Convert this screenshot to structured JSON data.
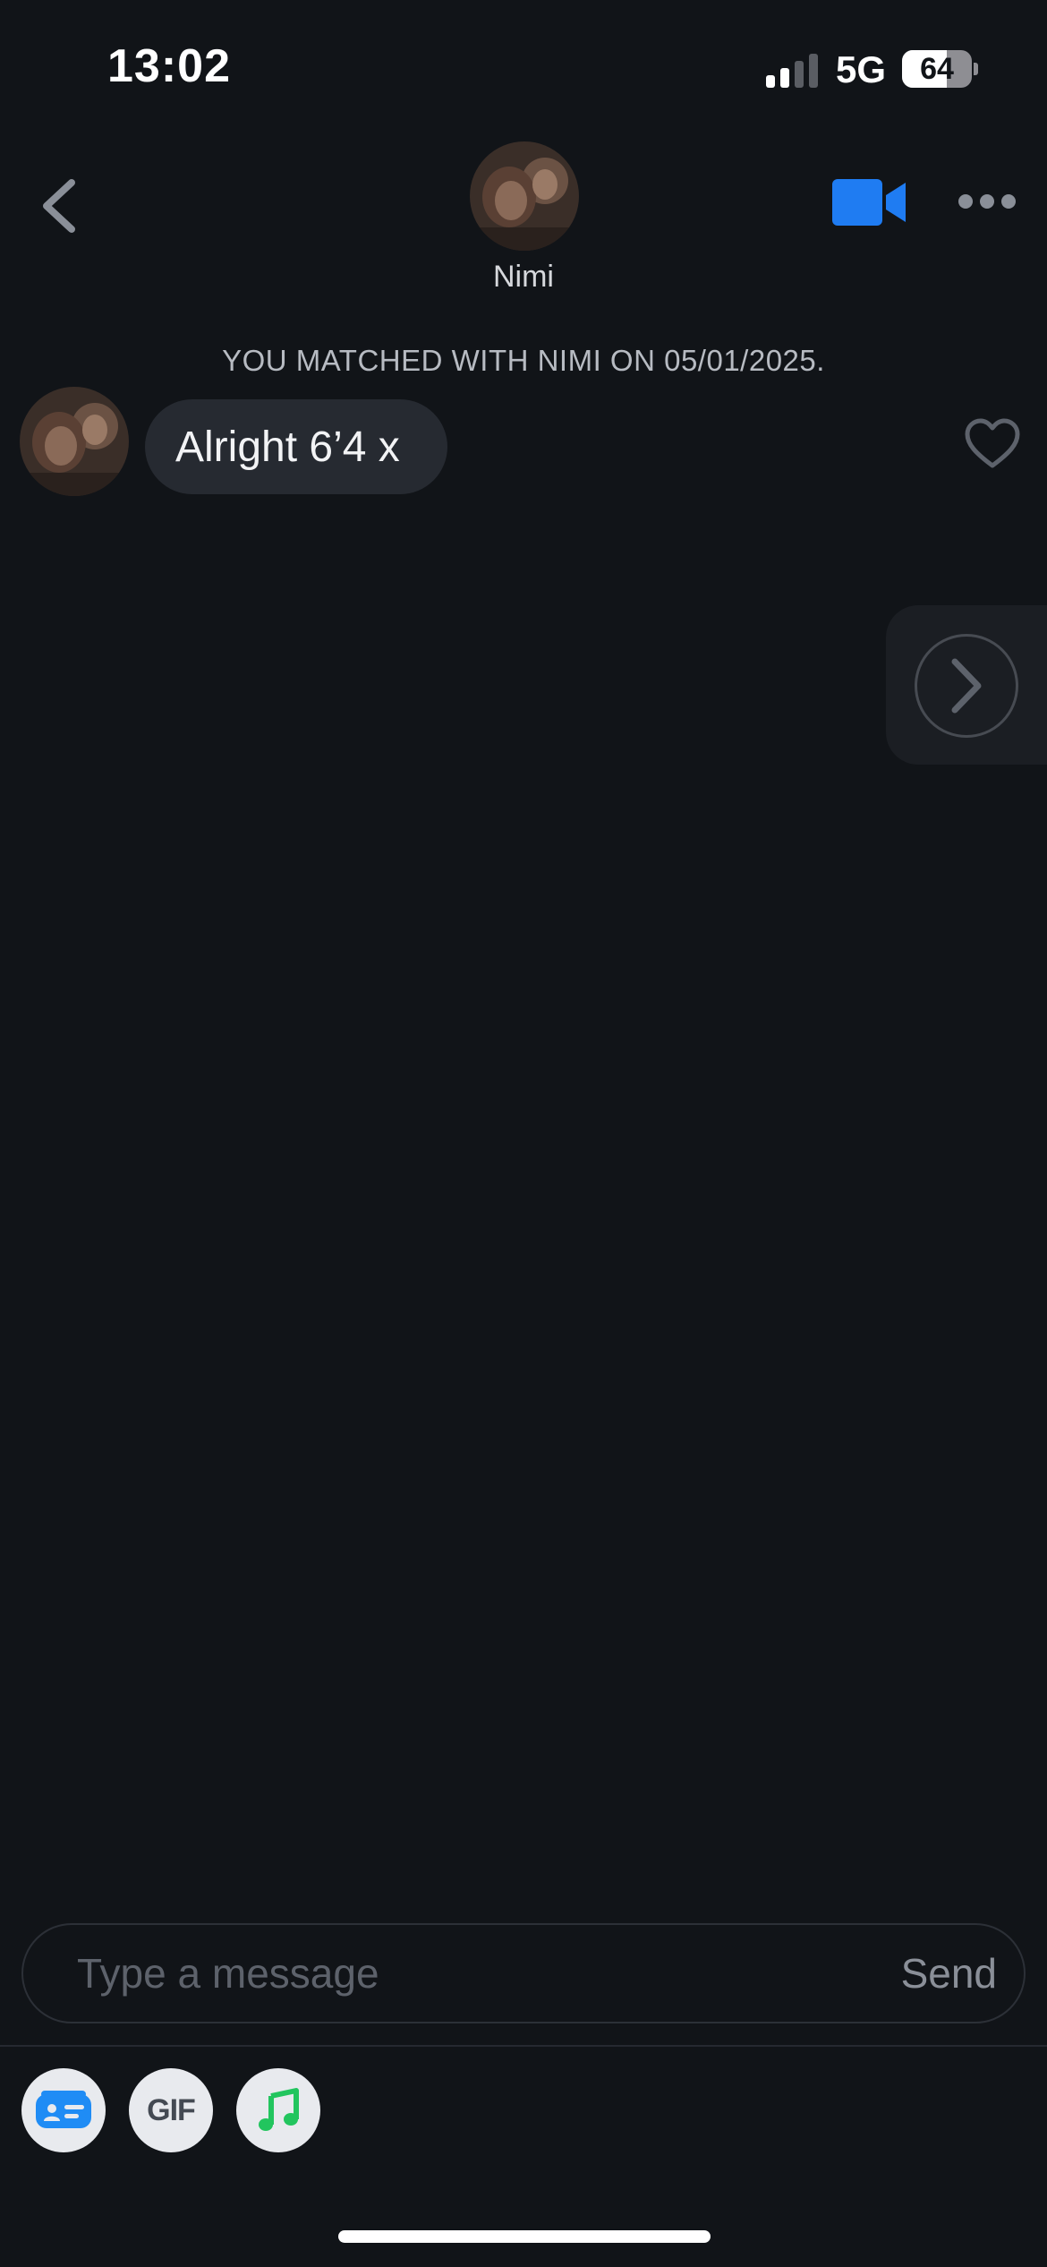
{
  "status_bar": {
    "time": "13:02",
    "network": "5G",
    "battery": "64",
    "battery_level": 0.64,
    "signal_bars": 2,
    "signal_bars_total": 4
  },
  "header": {
    "name": "Nimi",
    "back_icon": "chevron-left-icon",
    "video_icon": "video-camera-icon",
    "more_icon": "more-horizontal-icon",
    "accent_color": "#1f7cf2"
  },
  "conversation": {
    "match_notice": "YOU MATCHED WITH NIMI ON 05/01/2025.",
    "messages": [
      {
        "sender": "Nimi",
        "text": "Alright 6’4 x"
      }
    ],
    "like_icon": "heart-outline-icon",
    "side_icon": "chevron-right-icon"
  },
  "composer": {
    "placeholder": "Type a message",
    "value": "",
    "send_label": "Send"
  },
  "tools": {
    "card_icon": "contact-card-icon",
    "gif_label": "GIF",
    "music_icon": "music-note-icon"
  }
}
